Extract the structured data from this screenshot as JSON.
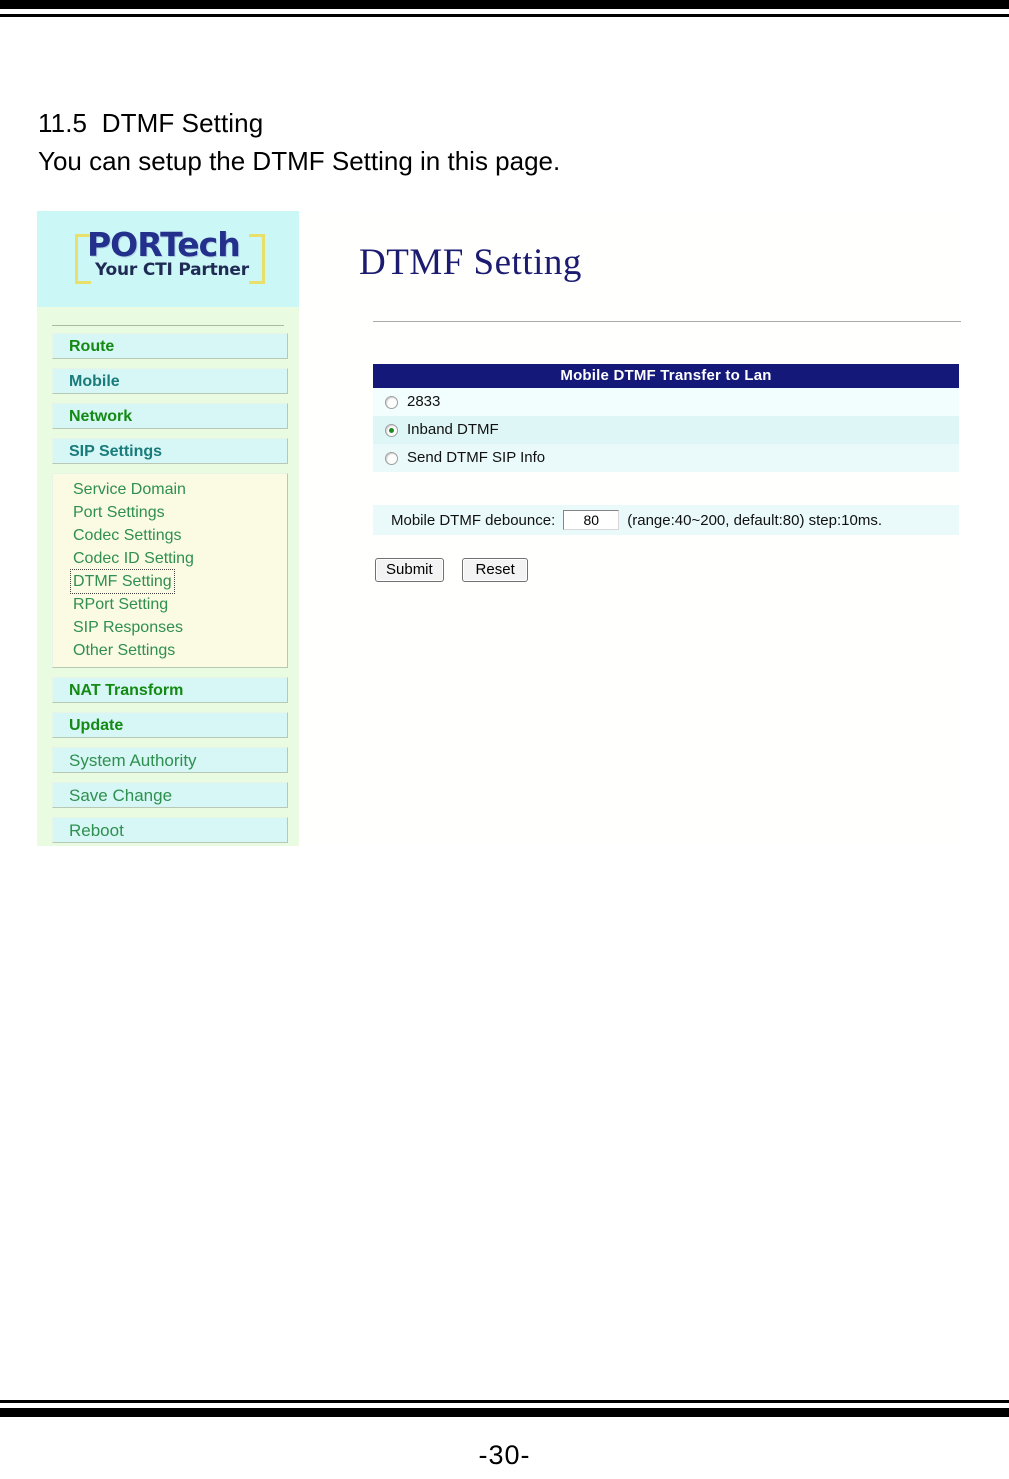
{
  "document": {
    "heading": "11.5  DTMF Setting",
    "subheading": "You can setup the DTMF Setting in this page.",
    "page_number": "-30-"
  },
  "screenshot": {
    "logo": {
      "word_por": "POR",
      "word_tech": "Tech",
      "tagline": "Your CTI Partner",
      "blue": "#23308c",
      "bracket_yellow": "#e8e06a",
      "header_bg": "#ccf7f7"
    },
    "sidebar": {
      "top_buttons": [
        {
          "label": "Route",
          "style": "green"
        },
        {
          "label": "Mobile",
          "style": "teal"
        },
        {
          "label": "Network",
          "style": "green"
        },
        {
          "label": "SIP Settings",
          "style": "teal"
        }
      ],
      "sub_items": [
        {
          "label": "Service Domain",
          "focused": false
        },
        {
          "label": "Port Settings",
          "focused": false
        },
        {
          "label": "Codec Settings",
          "focused": false
        },
        {
          "label": "Codec ID Setting",
          "focused": false
        },
        {
          "label": "DTMF Setting",
          "focused": true
        },
        {
          "label": "RPort Setting",
          "focused": false
        },
        {
          "label": "SIP Responses",
          "focused": false
        },
        {
          "label": "Other Settings",
          "focused": false
        }
      ],
      "bottom_buttons": [
        {
          "label": "NAT Transform",
          "style": "green"
        },
        {
          "label": "Update",
          "style": "green"
        }
      ],
      "plain_items": [
        {
          "label": "System Authority"
        },
        {
          "label": "Save Change"
        },
        {
          "label": "Reboot"
        }
      ]
    },
    "main": {
      "title": "DTMF Setting",
      "table_header": "Mobile DTMF Transfer to Lan",
      "options": [
        {
          "label": "2833",
          "selected": false
        },
        {
          "label": "Inband DTMF",
          "selected": true
        },
        {
          "label": "Send DTMF SIP Info",
          "selected": false
        }
      ],
      "debounce": {
        "label": "Mobile DTMF debounce:",
        "value": "80",
        "note": "(range:40~200, default:80) step:10ms."
      },
      "buttons": {
        "submit": "Submit",
        "reset": "Reset"
      },
      "colors": {
        "header_bg": "#141878",
        "title": "#1b1b70",
        "radio_dot": "#1f8a1f"
      }
    }
  }
}
